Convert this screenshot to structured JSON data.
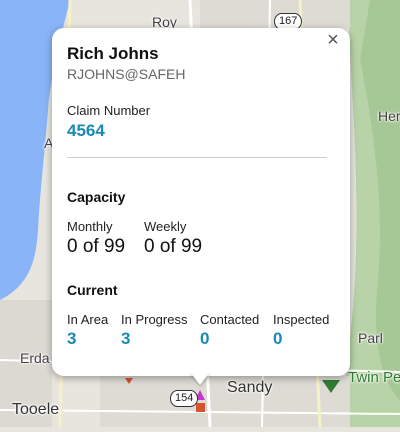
{
  "map": {
    "labels": {
      "roy": "Roy",
      "area_a": "A",
      "her": "Her",
      "erda": "Erda",
      "tooele": "Tooele",
      "sandy": "Sandy",
      "twin_peaks": "Twin Pe",
      "parl": "Parl"
    },
    "shields": {
      "r167": "167",
      "r154": "154"
    }
  },
  "popup": {
    "name": "Rich Johns",
    "email": "RJOHNS@SAFEH",
    "claim_label": "Claim Number",
    "claim_number": "4564",
    "capacity": {
      "title": "Capacity",
      "monthly_label": "Monthly",
      "monthly_value": "0 of 99",
      "weekly_label": "Weekly",
      "weekly_value": "0 of 99"
    },
    "current": {
      "title": "Current",
      "in_area_label": "In Area",
      "in_area_value": "3",
      "in_progress_label": "In Progress",
      "in_progress_value": "3",
      "contacted_label": "Contacted",
      "contacted_value": "0",
      "inspected_label": "Inspected",
      "inspected_value": "0"
    },
    "close_symbol": "×"
  },
  "colors": {
    "accent": "#1a8ab5",
    "water": "#8ab4f8",
    "land": "#e8e5df",
    "park": "#c8dfb9",
    "marker_purple": "#c239c9",
    "marker_orange": "#d8522e"
  }
}
